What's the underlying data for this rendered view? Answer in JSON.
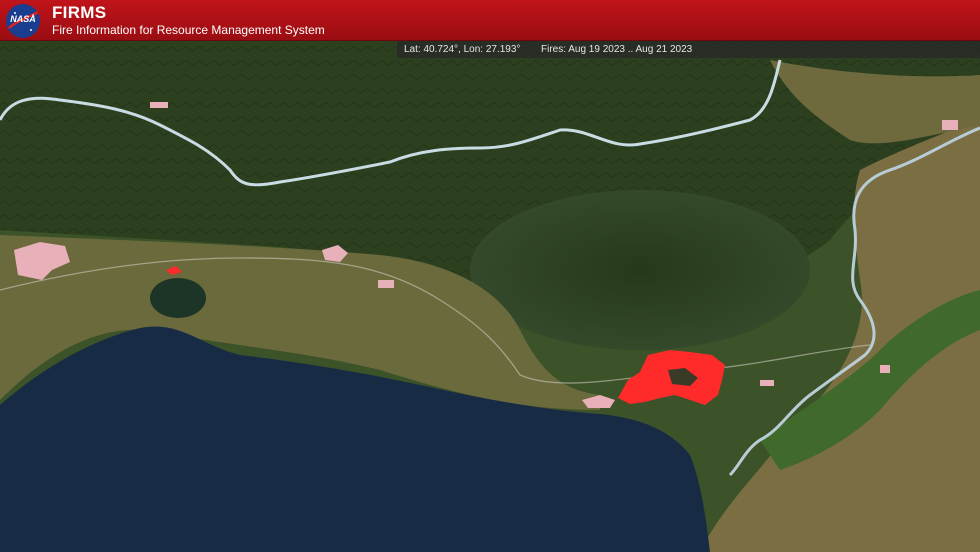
{
  "header": {
    "logo_label": "NASA",
    "title": "FIRMS",
    "subtitle": "Fire Information for Resource Management System"
  },
  "status": {
    "coords": "Lat: 40.724°, Lon: 27.193°",
    "fires": "Fires: Aug 19 2023 .. Aug 21 2023"
  },
  "colors": {
    "header": "#b0101a",
    "sea": "#182b45",
    "forest": "#2f4420",
    "plains": "#6b6a3c",
    "border": "#c9dbe3",
    "fire": "#ff2a2a",
    "urban": "#e8b0b8"
  }
}
